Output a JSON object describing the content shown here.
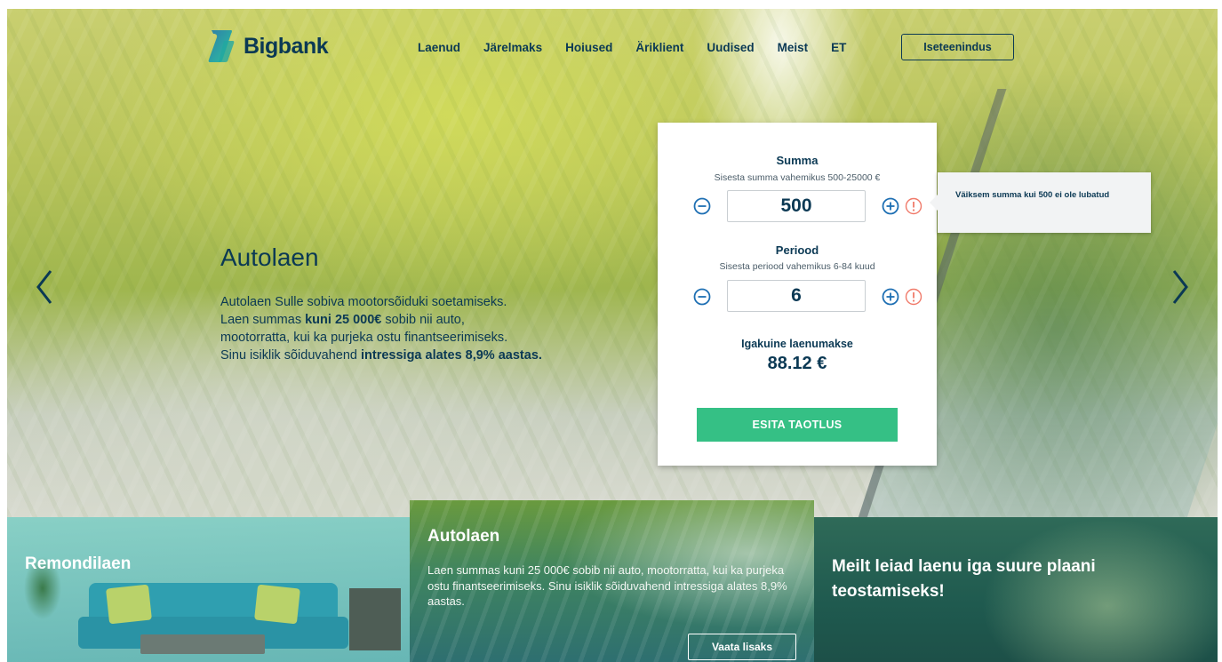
{
  "header": {
    "logo_text": "Bigbank",
    "nav": [
      "Laenud",
      "Järelmaks",
      "Hoiused",
      "Äriklient",
      "Uudised",
      "Meist",
      "ET"
    ],
    "selfservice_label": "Iseteenindus"
  },
  "hero": {
    "title": "Autolaen",
    "body": {
      "p1": "Autolaen Sulle sobiva mootorsõiduki soetamiseks.",
      "p2_pre": "Laen summas ",
      "p2_bold": "kuni 25 000€",
      "p2_post": " sobib nii auto,",
      "p3": "mootorratta, kui ka purjeka ostu finantseerimiseks.",
      "p4_pre": "Sinu isiklik sõiduvahend ",
      "p4_bold": "intressiga alates 8,9% aastas."
    }
  },
  "calculator": {
    "amount_label": "Summa",
    "amount_hint": "Sisesta summa vahemikus 500-25000 €",
    "amount_value": "500",
    "period_label": "Periood",
    "period_hint": "Sisesta periood vahemikus 6-84 kuud",
    "period_value": "6",
    "monthly_label": "Igakuine laenumakse",
    "monthly_value": "88.12 €",
    "submit_label": "ESITA TAOTLUS",
    "tooltip": "Väiksem summa kui 500 ei ole lubatud"
  },
  "tiles": {
    "t1_title": "Remondilaen",
    "t2_title": "Autolaen",
    "t2_body": "Laen summas kuni 25 000€ sobib nii auto, mootorratta, kui ka purjeka ostu finantseerimiseks. Sinu isiklik sõiduvahend intressiga alates 8,9% aastas.",
    "t2_button": "Vaata lisaks",
    "t3_title": "Meilt leiad laenu iga suure plaani teostamiseks!"
  },
  "colors": {
    "brand_navy": "#0b3954",
    "accent_green": "#35c085",
    "warning": "#f07a6a"
  },
  "icons": [
    "logo-mark-icon",
    "minus-circle-icon",
    "plus-circle-icon",
    "warning-icon",
    "chevron-left-icon",
    "chevron-right-icon"
  ]
}
